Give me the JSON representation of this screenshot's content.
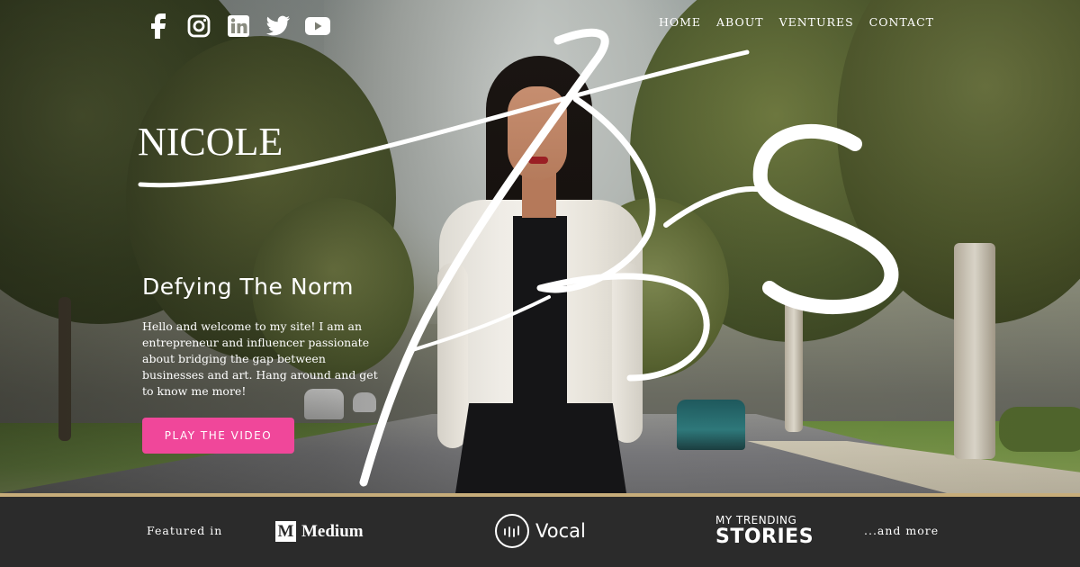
{
  "social": [
    {
      "name": "facebook-icon"
    },
    {
      "name": "instagram-icon"
    },
    {
      "name": "linkedin-icon"
    },
    {
      "name": "twitter-icon"
    },
    {
      "name": "youtube-icon"
    }
  ],
  "nav": {
    "home": "HOME",
    "about": "ABOUT",
    "ventures": "VENTURES",
    "contact": "CONTACT"
  },
  "hero": {
    "logo_text": "NICOLE",
    "headline": "Defying The Norm",
    "intro": "Hello and welcome to my site! I am an entrepreneur and influencer passionate about bridging the gap between businesses and art. Hang around and get to know me more!",
    "cta_label": "PLAY THE VIDEO"
  },
  "featured": {
    "label": "Featured in",
    "medium": {
      "mark": "M",
      "word": "Medium"
    },
    "vocal": {
      "word": "Vocal"
    },
    "trending": {
      "top": "MY TRENDING",
      "bottom": "STORIES"
    },
    "more": "...and more"
  },
  "colors": {
    "cta": "#f0479a",
    "gold_rule": "#c7ad7a",
    "footer_bg": "#2b2b2b",
    "text": "#ffffff"
  }
}
